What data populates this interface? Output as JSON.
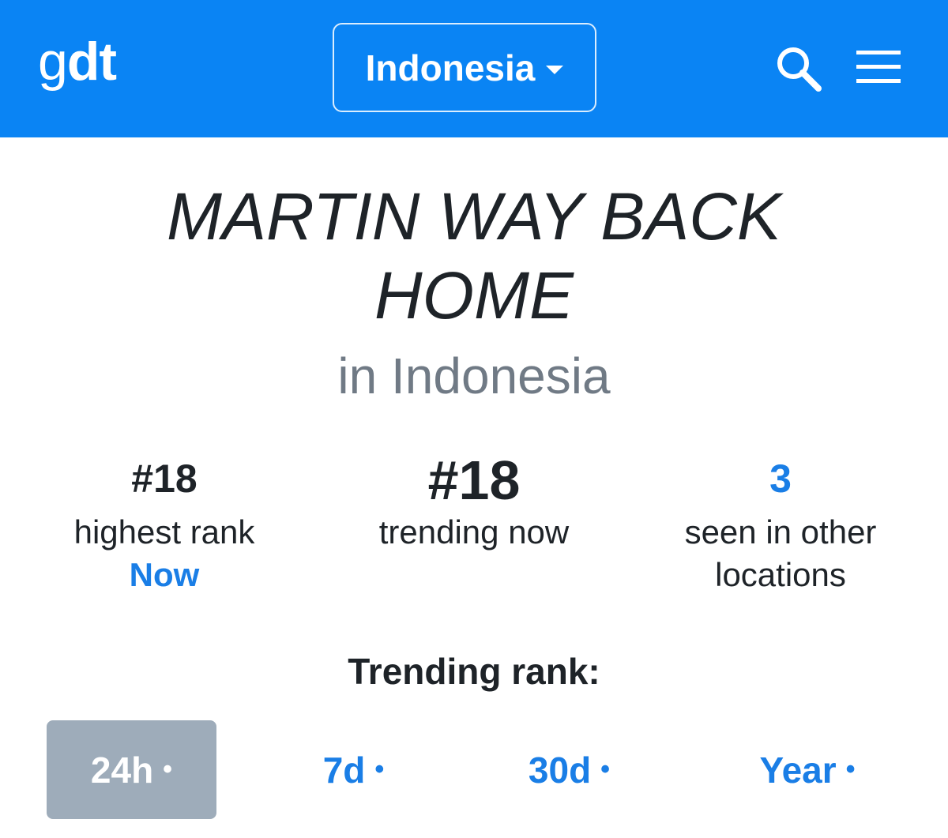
{
  "header": {
    "logo_g": "g",
    "logo_dt": "dt",
    "country": "Indonesia",
    "search_icon": "search-icon",
    "menu_icon": "hamburger-menu-icon",
    "bg_color": "#0a84f4"
  },
  "topic": {
    "title": "MARTIN WAY BACK HOME",
    "subtitle": "in Indonesia"
  },
  "stats": [
    {
      "value": "#18",
      "label": "highest rank",
      "link": "Now"
    },
    {
      "value": "#18",
      "label": "trending now"
    },
    {
      "value": "3",
      "label": "seen in other locations"
    }
  ],
  "trending": {
    "heading": "Trending rank:",
    "tabs": [
      {
        "label": "24h",
        "dot": "•",
        "active": true
      },
      {
        "label": "7d",
        "dot": "•",
        "active": false
      },
      {
        "label": "30d",
        "dot": "•",
        "active": false
      },
      {
        "label": "Year",
        "dot": "•",
        "active": false
      }
    ],
    "active_color": "#9eacba",
    "link_color": "#1a7ee6"
  }
}
